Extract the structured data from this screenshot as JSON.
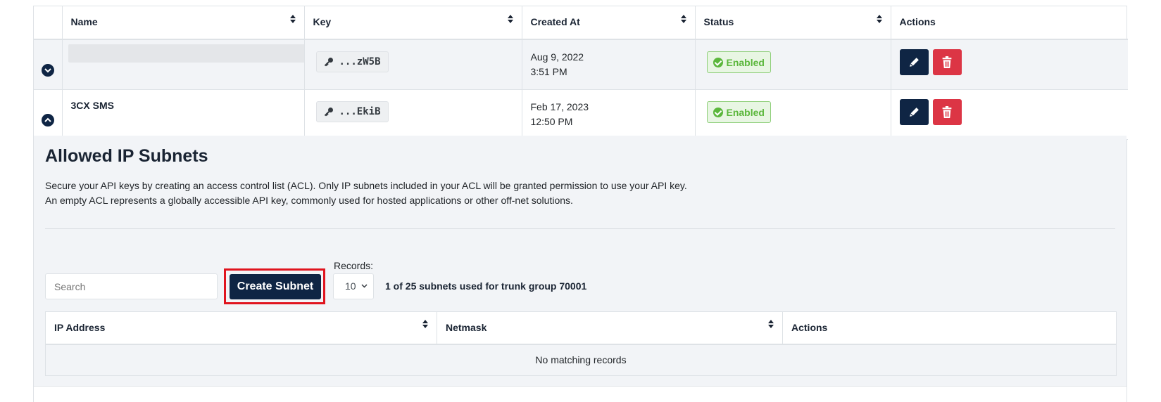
{
  "keys_table": {
    "columns": {
      "name": "Name",
      "key": "Key",
      "created": "Created At",
      "status": "Status",
      "actions": "Actions"
    },
    "rows": [
      {
        "name": "",
        "key": "...zW5B",
        "created_date": "Aug 9, 2022",
        "created_time": "3:51 PM",
        "status": "Enabled"
      },
      {
        "name": "3CX SMS",
        "key": "...EkiB",
        "created_date": "Feb 17, 2023",
        "created_time": "12:50 PM",
        "status": "Enabled"
      }
    ]
  },
  "subnets_panel": {
    "title": "Allowed IP Subnets",
    "desc_line1": "Secure your API keys by creating an access control list (ACL). Only IP subnets included in your ACL will be granted permission to use your API key.",
    "desc_line2": "An empty ACL represents a globally accessible API key, commonly used for hosted applications or other off-net solutions.",
    "search_placeholder": "Search",
    "create_label": "Create Subnet",
    "records_label": "Records:",
    "records_value": "10",
    "usage_text": "1 of 25 subnets used for trunk group 70001",
    "columns": {
      "ip": "IP Address",
      "netmask": "Netmask",
      "actions": "Actions"
    },
    "empty_text": "No matching records"
  },
  "colors": {
    "primary": "#0f2544",
    "danger": "#dc3545",
    "success": "#5bb73c",
    "highlight": "#e0141e"
  },
  "icons": [
    "chevron-down-icon",
    "chevron-up-icon",
    "key-icon",
    "check-circle-icon",
    "pencil-icon",
    "trash-icon",
    "sort-icon"
  ]
}
